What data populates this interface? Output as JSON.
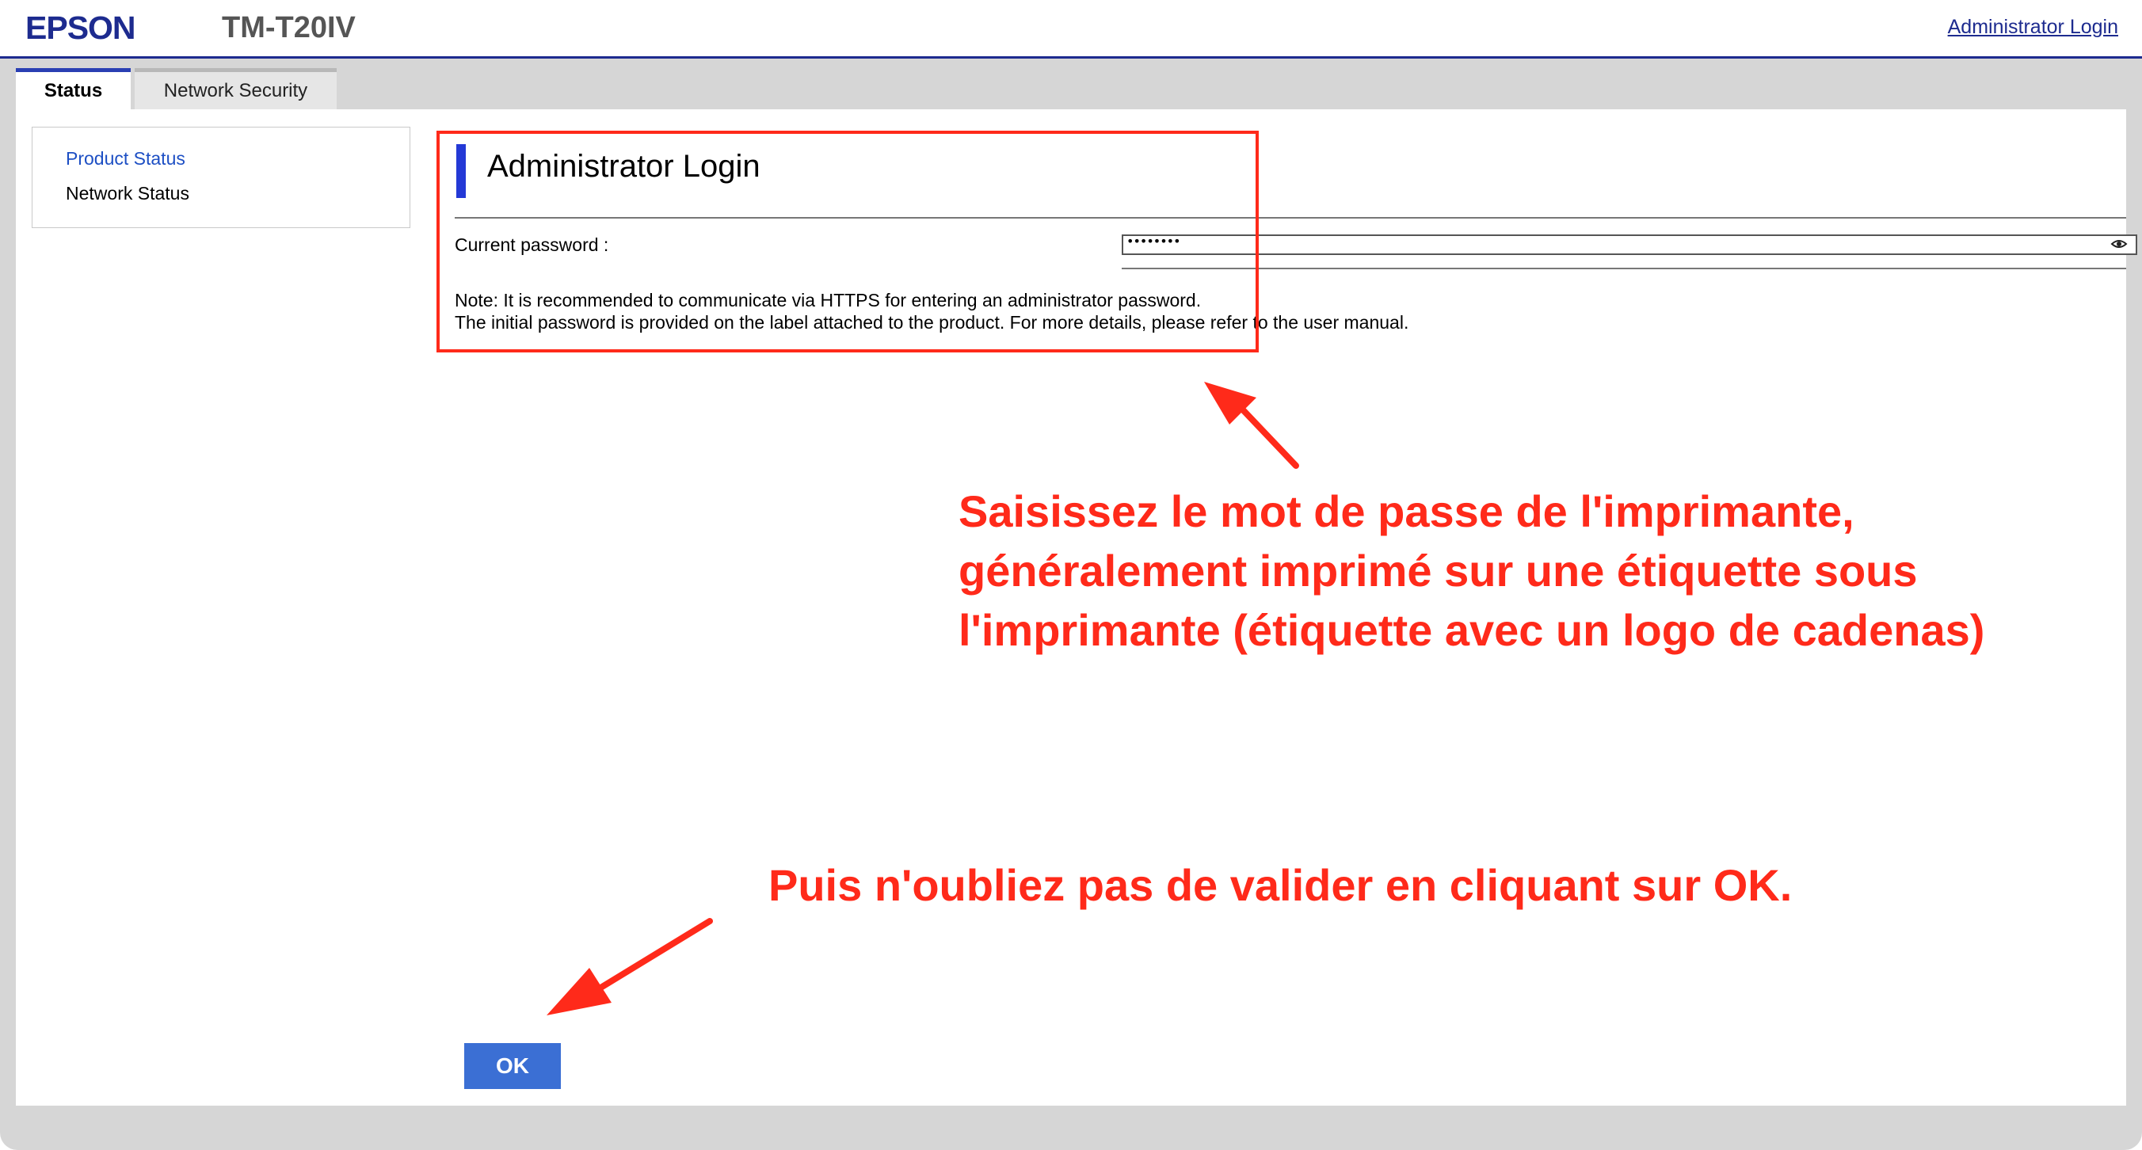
{
  "header": {
    "brand": "EPSON",
    "model": "TM-T20IV",
    "admin_link": "Administrator Login"
  },
  "tabs": [
    {
      "label": "Status",
      "active": true
    },
    {
      "label": "Network Security",
      "active": false
    }
  ],
  "sidebar": {
    "items": [
      {
        "label": "Product Status",
        "active": true
      },
      {
        "label": "Network Status",
        "active": false
      }
    ]
  },
  "login": {
    "title": "Administrator Login",
    "password_label": "Current password :",
    "password_masked": "••••••••",
    "note_line1": "Note: It is recommended to communicate via HTTPS for entering an administrator password.",
    "note_line2": "The initial password is provided on the label attached to the product. For more details, please refer to the user manual.",
    "ok_label": "OK"
  },
  "annotations": {
    "callout1": "Saisissez le mot de passe de l'imprimante, généralement imprimé sur une étiquette sous l'imprimante (étiquette avec un logo de cadenas)",
    "callout2": "Puis n'oubliez pas de valider en cliquant sur OK.",
    "color": "#ff2a1a"
  },
  "colors": {
    "brand": "#1d2b8f",
    "accent": "#2439d6",
    "button": "#3b6fd4",
    "link_active": "#1d4fc4"
  }
}
